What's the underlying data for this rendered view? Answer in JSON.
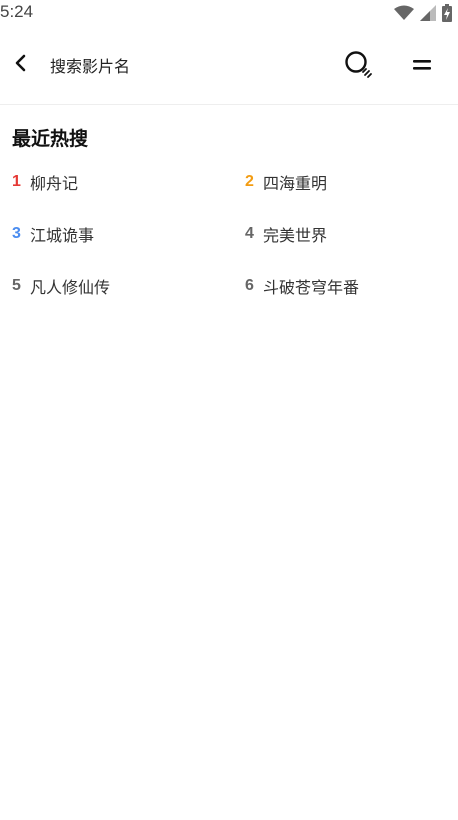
{
  "status_bar": {
    "time": "5:24",
    "icons": [
      "wifi-icon",
      "signal-icon",
      "battery-charging-icon"
    ]
  },
  "app_bar": {
    "back_icon": "chevron-left-icon",
    "search_placeholder": "搜索影片名",
    "search_icon": "search-icon",
    "menu_icon": "menu-icon"
  },
  "recent": {
    "title": "最近热搜",
    "items": [
      {
        "rank": "1",
        "name": "柳舟记",
        "rank_color": "#e53935"
      },
      {
        "rank": "2",
        "name": "四海重明",
        "rank_color": "#f39c12"
      },
      {
        "rank": "3",
        "name": "江城诡事",
        "rank_color": "#4a8cf0"
      },
      {
        "rank": "4",
        "name": "完美世界",
        "rank_color": "#666666"
      },
      {
        "rank": "5",
        "name": "凡人修仙传",
        "rank_color": "#666666"
      },
      {
        "rank": "6",
        "name": "斗破苍穹年番",
        "rank_color": "#666666"
      }
    ]
  }
}
